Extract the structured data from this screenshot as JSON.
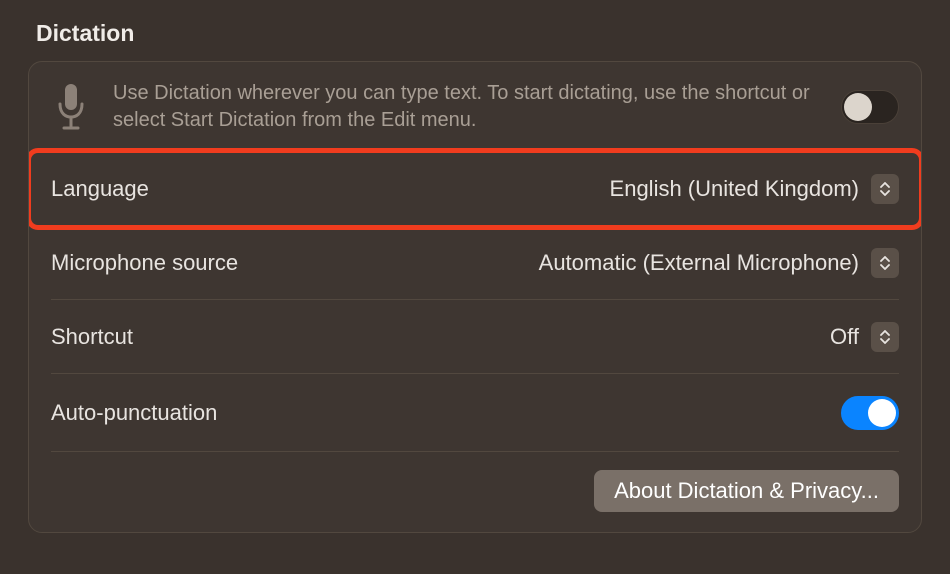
{
  "section": {
    "title": "Dictation"
  },
  "header": {
    "description": "Use Dictation wherever you can type text. To start dictating, use the shortcut or select Start Dictation from the Edit menu.",
    "toggle_on": false
  },
  "rows": {
    "language": {
      "label": "Language",
      "value": "English (United Kingdom)"
    },
    "microphone": {
      "label": "Microphone source",
      "value": "Automatic (External Microphone)"
    },
    "shortcut": {
      "label": "Shortcut",
      "value": "Off"
    },
    "autopunctuation": {
      "label": "Auto-punctuation",
      "toggle_on": true
    }
  },
  "footer": {
    "about_label": "About Dictation & Privacy..."
  }
}
